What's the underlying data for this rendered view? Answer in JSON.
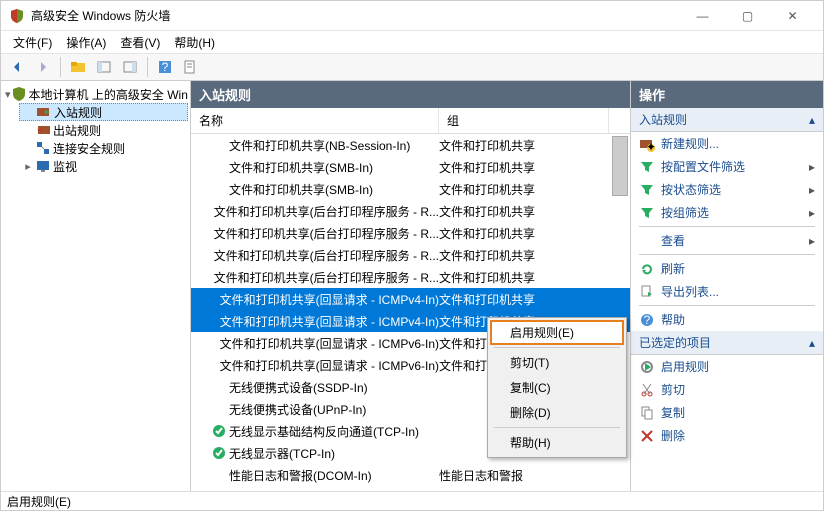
{
  "window": {
    "title": "高级安全 Windows 防火墙",
    "min": "—",
    "max": "▢",
    "close": "✕"
  },
  "menu": {
    "file": "文件(F)",
    "action": "操作(A)",
    "view": "查看(V)",
    "help": "帮助(H)"
  },
  "tree": {
    "root": "本地计算机 上的高级安全 Win",
    "inbound": "入站规则",
    "outbound": "出站规则",
    "connsec": "连接安全规则",
    "monitor": "监视"
  },
  "center": {
    "header": "入站规则",
    "col_name": "名称",
    "col_group": "组",
    "rows": [
      {
        "name": "文件和打印机共享(NB-Session-In)",
        "group": "文件和打印机共享",
        "en": false
      },
      {
        "name": "文件和打印机共享(SMB-In)",
        "group": "文件和打印机共享",
        "en": false
      },
      {
        "name": "文件和打印机共享(SMB-In)",
        "group": "文件和打印机共享",
        "en": false
      },
      {
        "name": "文件和打印机共享(后台打印程序服务 - R...",
        "group": "文件和打印机共享",
        "en": false
      },
      {
        "name": "文件和打印机共享(后台打印程序服务 - R...",
        "group": "文件和打印机共享",
        "en": false
      },
      {
        "name": "文件和打印机共享(后台打印程序服务 - R...",
        "group": "文件和打印机共享",
        "en": false
      },
      {
        "name": "文件和打印机共享(后台打印程序服务 - R...",
        "group": "文件和打印机共享",
        "en": false
      },
      {
        "name": "文件和打印机共享(回显请求 - ICMPv4-In)",
        "group": "文件和打印机共享",
        "en": false,
        "sel": true
      },
      {
        "name": "文件和打印机共享(回显请求 - ICMPv4-In)",
        "group": "文件和打印机共享",
        "en": false,
        "sel": true
      },
      {
        "name": "文件和打印机共享(回显请求 - ICMPv6-In)",
        "group": "文件和打印机共享",
        "en": false
      },
      {
        "name": "文件和打印机共享(回显请求 - ICMPv6-In)",
        "group": "文件和打印机共享",
        "en": false
      },
      {
        "name": "无线便携式设备(SSDP-In)",
        "group": "",
        "en": false
      },
      {
        "name": "无线便携式设备(UPnP-In)",
        "group": "",
        "en": false
      },
      {
        "name": "无线显示基础结构反向通道(TCP-In)",
        "group": "",
        "en": true
      },
      {
        "name": "无线显示器(TCP-In)",
        "group": "",
        "en": true
      },
      {
        "name": "性能日志和警报(DCOM-In)",
        "group": "性能日志和警报",
        "en": false
      }
    ]
  },
  "ctx": {
    "enable": "启用规则(E)",
    "cut": "剪切(T)",
    "copy": "复制(C)",
    "delete": "删除(D)",
    "help": "帮助(H)"
  },
  "actions": {
    "header": "操作",
    "sec1": "入站规则",
    "new_rule": "新建规则...",
    "filter_profile": "按配置文件筛选",
    "filter_state": "按状态筛选",
    "filter_group": "按组筛选",
    "view": "查看",
    "refresh": "刷新",
    "export": "导出列表...",
    "help": "帮助",
    "sec2": "已选定的项目",
    "enable": "启用规则",
    "cut": "剪切",
    "copy": "复制",
    "delete": "删除"
  },
  "status": "启用规则(E)"
}
